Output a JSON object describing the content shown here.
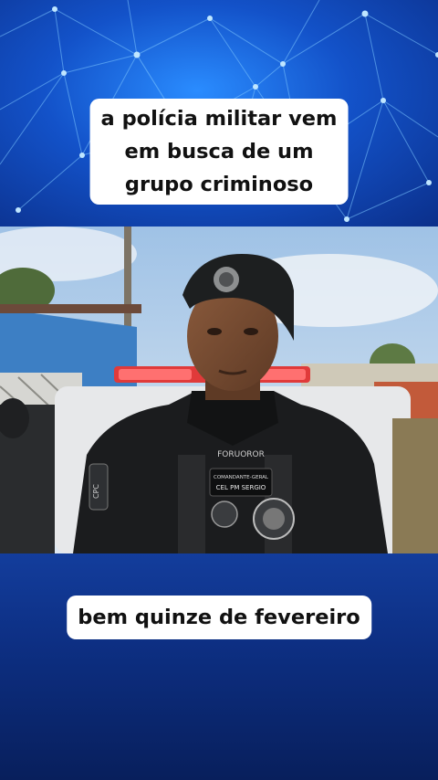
{
  "caption_top": {
    "lines": [
      "a polícia militar vem",
      "em busca de um",
      "grupo criminoso"
    ]
  },
  "caption_bottom": {
    "text": "bem quinze de fevereiro"
  },
  "photo": {
    "patch_text": "FORUOROR",
    "name_tag_line1": "COMANDANTE-GERAL",
    "name_tag_line2": "CEL PM SERGIO",
    "sleeve_text": "CPC"
  },
  "colors": {
    "network_bg": "#1352c9",
    "bottom_bg": "#0d2f83",
    "caption_bg": "#ffffff",
    "caption_text": "#111111"
  }
}
